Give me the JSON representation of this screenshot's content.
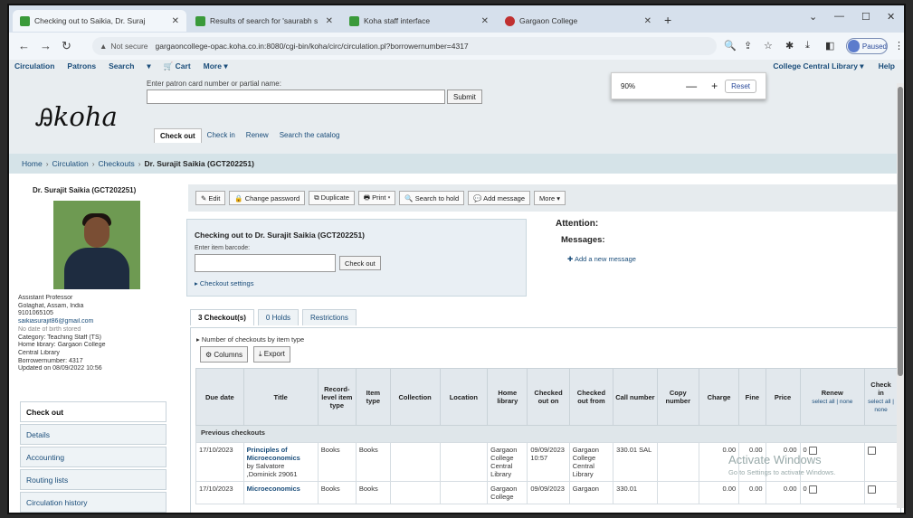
{
  "browser": {
    "tabs": [
      {
        "title": "Checking out to Saikia, Dr. Suraj",
        "color": "#3a9a3a",
        "active": true
      },
      {
        "title": "Results of search for 'saurabh s",
        "color": "#3a9a3a"
      },
      {
        "title": "Koha staff interface",
        "color": "#3a9a3a"
      },
      {
        "title": "Gargaon College",
        "color": "#c03030"
      }
    ],
    "new_tab": "+",
    "security_label": "Not secure",
    "url": "gargaoncollege-opac.koha.co.in:8080/cgi-bin/koha/circ/circulation.pl?borrowernumber=4317",
    "profile_label": "Paused"
  },
  "zoom": {
    "value": "90%",
    "minus": "—",
    "plus": "+",
    "reset": "Reset"
  },
  "koha": {
    "topnav": [
      "Circulation",
      "Patrons",
      "Search",
      "▾",
      "🛒 Cart",
      "More ▾"
    ],
    "library": "College Central Library ▾",
    "help": "Help",
    "logo_text": "koha",
    "patron_prompt": "Enter patron card number or partial name:",
    "submit": "Submit",
    "subtabs": [
      "Check out",
      "Check in",
      "Renew",
      "Search the catalog"
    ]
  },
  "breadcrumb": [
    "Home",
    "Circulation",
    "Checkouts",
    "Dr. Surajit Saikia (GCT202251)"
  ],
  "patron": {
    "name": "Dr. Surajit Saikia (GCT202251)",
    "info": [
      "Assistant Professor",
      "Golaghat, Assam, India",
      "9101065105",
      "saikiasurajit86@gmail.com",
      "No date of birth stored",
      "Category: Teaching Staff (TS)",
      "Home library: Gargaon College",
      "Central Library",
      "Borrowernumber: 4317",
      "Updated on 08/09/2022 10:56"
    ],
    "menu": [
      "Check out",
      "Details",
      "Accounting",
      "Routing lists",
      "Circulation history"
    ]
  },
  "toolbar": [
    "✎ Edit",
    "🔒 Change password",
    "⧉ Duplicate",
    "🖶 Print ▾",
    "🔍 Search to hold",
    "💬 Add message",
    "More ▾"
  ],
  "checkout": {
    "title": "Checking out to Dr. Surajit Saikia (GCT202251)",
    "barcode_label": "Enter item barcode:",
    "button": "Check out",
    "settings": "▸ Checkout settings"
  },
  "attention": "Attention:",
  "messages": "Messages:",
  "add_message": "✚ Add a new message",
  "checkout_tabs": [
    "3 Checkout(s)",
    "0 Holds",
    "Restrictions"
  ],
  "table": {
    "number_by_type": "▸ Number of checkouts by item type",
    "columns_btn": "⚙ Columns",
    "export_btn": "⤓ Export",
    "headers": [
      "Due date",
      "Title",
      "Record-level item type",
      "Item type",
      "Collection",
      "Location",
      "Home library",
      "Checked out on",
      "Checked out from",
      "Call number",
      "Copy number",
      "Charge",
      "Fine",
      "Price",
      "Renew",
      "Check in"
    ],
    "select_all": "select all | none",
    "group": "Previous checkouts",
    "rows": [
      {
        "due": "17/10/2023",
        "title": "Principles of Microeconomics",
        "author": "by Salvatore ,Dominick 29061",
        "record_type": "Books",
        "item_type": "Books",
        "home": "Gargaon College Central Library",
        "out_on": "09/09/2023 10:57",
        "out_from": "Gargaon College Central Library",
        "call": "330.01 SAL",
        "charge": "0.00",
        "fine": "0.00",
        "price": "0.00",
        "renew": "0"
      },
      {
        "due": "17/10/2023",
        "title": "Microeconomics",
        "author": "",
        "record_type": "Books",
        "item_type": "Books",
        "home": "Gargaon College",
        "out_on": "09/09/2023",
        "out_from": "Gargaon",
        "call": "330.01",
        "charge": "0.00",
        "fine": "0.00",
        "price": "0.00",
        "renew": "0"
      }
    ]
  },
  "watermark": {
    "line1": "Activate Windows",
    "line2": "Go to Settings to activate Windows."
  }
}
